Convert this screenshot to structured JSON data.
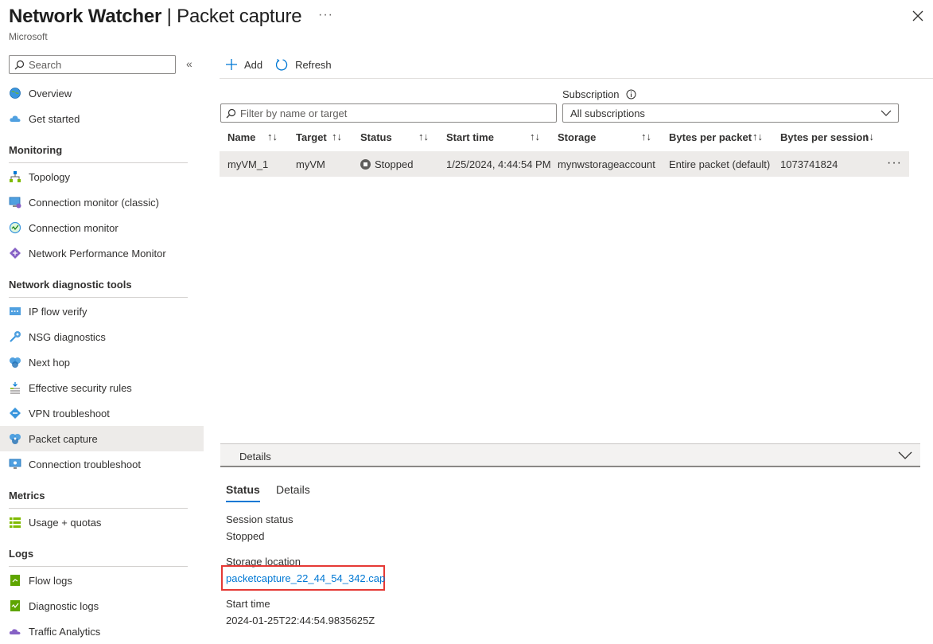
{
  "header": {
    "title_bold": "Network Watcher",
    "title_sep": " | ",
    "title_rest": "Packet capture",
    "subtitle": "Microsoft",
    "more": "···"
  },
  "sidebar": {
    "search_placeholder": "Search",
    "collapse": "«",
    "top_items": [
      {
        "label": "Overview",
        "icon": "globe-icon"
      },
      {
        "label": "Get started",
        "icon": "cloud-icon"
      }
    ],
    "sections": [
      {
        "title": "Monitoring",
        "items": [
          {
            "label": "Topology",
            "icon": "topology-icon"
          },
          {
            "label": "Connection monitor (classic)",
            "icon": "monitor-icon"
          },
          {
            "label": "Connection monitor",
            "icon": "connection-monitor-icon"
          },
          {
            "label": "Network Performance Monitor",
            "icon": "npm-icon"
          }
        ]
      },
      {
        "title": "Network diagnostic tools",
        "items": [
          {
            "label": "IP flow verify",
            "icon": "ip-flow-icon"
          },
          {
            "label": "NSG diagnostics",
            "icon": "nsg-icon"
          },
          {
            "label": "Next hop",
            "icon": "next-hop-icon"
          },
          {
            "label": "Effective security rules",
            "icon": "security-rules-icon"
          },
          {
            "label": "VPN troubleshoot",
            "icon": "vpn-icon"
          },
          {
            "label": "Packet capture",
            "icon": "packet-capture-icon"
          },
          {
            "label": "Connection troubleshoot",
            "icon": "connection-troubleshoot-icon"
          }
        ]
      },
      {
        "title": "Metrics",
        "items": [
          {
            "label": "Usage + quotas",
            "icon": "usage-icon"
          }
        ]
      },
      {
        "title": "Logs",
        "items": [
          {
            "label": "Flow logs",
            "icon": "flow-logs-icon"
          },
          {
            "label": "Diagnostic logs",
            "icon": "diagnostic-logs-icon"
          },
          {
            "label": "Traffic Analytics",
            "icon": "traffic-analytics-icon"
          }
        ]
      }
    ]
  },
  "toolbar": {
    "add_label": "Add",
    "refresh_label": "Refresh"
  },
  "filter": {
    "placeholder": "Filter by name or target",
    "subscription_label": "Subscription",
    "subscription_value": "All subscriptions"
  },
  "grid": {
    "columns": [
      "Name",
      "Target",
      "Status",
      "Start time",
      "Storage",
      "Bytes per packet",
      "Bytes per session"
    ],
    "sort_glyph": "↑↓",
    "row": {
      "name": "myVM_1",
      "target": "myVM",
      "status": "Stopped",
      "start_time": "1/25/2024, 4:44:54 PM",
      "storage": "mynwstorageaccount",
      "bytes_per_packet": "Entire packet (default)",
      "bytes_per_session": "1073741824",
      "more": "···"
    }
  },
  "details": {
    "bar_title": "Details",
    "tabs": [
      "Status",
      "Details"
    ],
    "session_status_label": "Session status",
    "session_status_value": "Stopped",
    "storage_location_label": "Storage location",
    "storage_location_value": "packetcapture_22_44_54_342.cap",
    "start_time_label": "Start time",
    "start_time_value": "2024-01-25T22:44:54.9835625Z"
  },
  "colors": {
    "accent": "#0078d4",
    "highlight_box": "#e53935",
    "selected_bg": "#edebe9"
  }
}
